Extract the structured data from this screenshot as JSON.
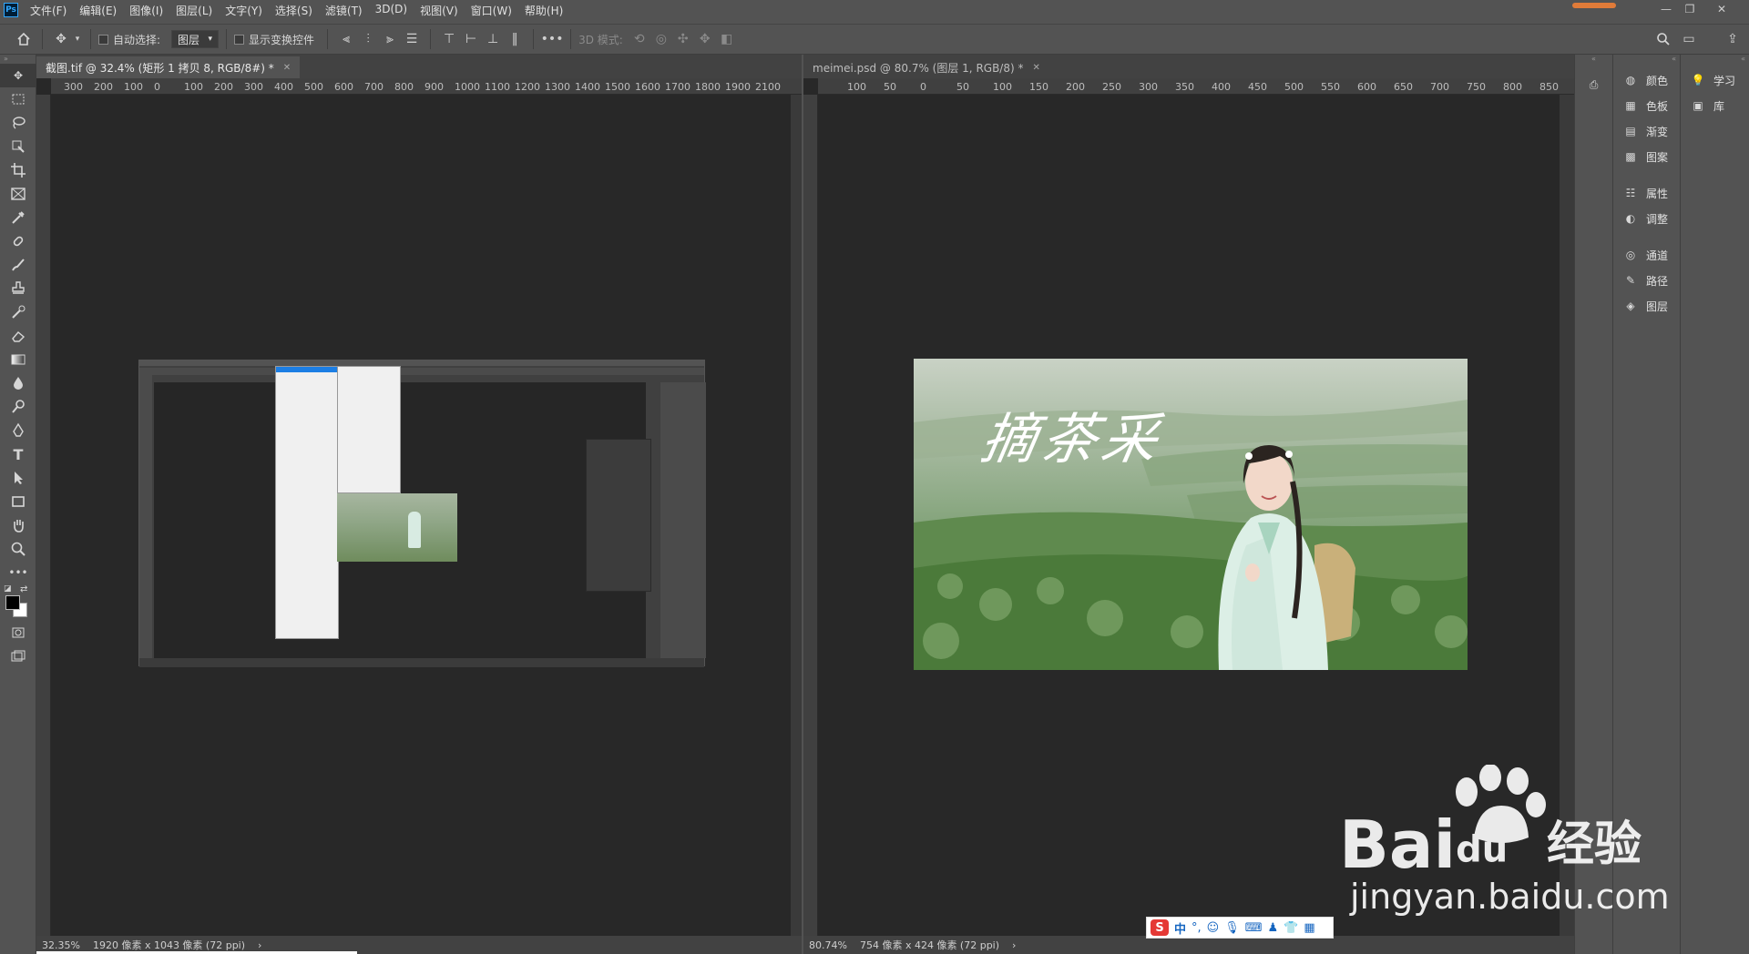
{
  "app": {
    "logo": "Ps"
  },
  "menubar": {
    "items": [
      "文件(F)",
      "编辑(E)",
      "图像(I)",
      "图层(L)",
      "文字(Y)",
      "选择(S)",
      "滤镜(T)",
      "3D(D)",
      "视图(V)",
      "窗口(W)",
      "帮助(H)"
    ]
  },
  "options": {
    "auto_select_label": "自动选择:",
    "auto_select_value": "图层",
    "show_transform_label": "显示变换控件",
    "mode_3d_label": "3D 模式:",
    "more": "•••"
  },
  "left_doc": {
    "tab_title": "截图.tif @ 32.4% (矩形 1 拷贝 8, RGB/8#) *",
    "ruler_labels": [
      "300",
      "200",
      "100",
      "0",
      "100",
      "200",
      "300",
      "400",
      "500",
      "600",
      "700",
      "800",
      "900",
      "1000",
      "1100",
      "1200",
      "1300",
      "1400",
      "1500",
      "1600",
      "1700",
      "1800",
      "1900",
      "2100"
    ],
    "zoom": "32.35%",
    "doc_info": "1920 像素 x 1043 像素 (72 ppi)"
  },
  "right_doc": {
    "tab_title": "meimei.psd @ 80.7% (图层 1, RGB/8) *",
    "ruler_labels": [
      "100",
      "50",
      "0",
      "50",
      "100",
      "150",
      "200",
      "250",
      "300",
      "350",
      "400",
      "450",
      "500",
      "550",
      "600",
      "650",
      "700",
      "750",
      "800",
      "850"
    ],
    "zoom": "80.74%",
    "doc_info": "754 像素 x 424 像素 (72 ppi)",
    "photo_text": "摘茶采"
  },
  "panels": {
    "col1": [
      {
        "icon": "color-icon",
        "label": "颜色"
      },
      {
        "icon": "swatches-icon",
        "label": "色板"
      },
      {
        "icon": "gradient-icon",
        "label": "渐变"
      },
      {
        "icon": "patterns-icon",
        "label": "图案"
      },
      {
        "icon": "properties-icon",
        "label": "属性"
      },
      {
        "icon": "adjustments-icon",
        "label": "调整"
      },
      {
        "icon": "channels-icon",
        "label": "通道"
      },
      {
        "icon": "paths-icon",
        "label": "路径"
      },
      {
        "icon": "layers-icon",
        "label": "图层"
      }
    ],
    "col2": [
      {
        "icon": "learn-icon",
        "label": "学习"
      },
      {
        "icon": "libraries-icon",
        "label": "库"
      }
    ]
  },
  "watermark": {
    "brand": "Bai",
    "brand2": "du",
    "cn": "经验",
    "url": "jingyan.baidu.com"
  },
  "ime": {
    "label": "中"
  }
}
